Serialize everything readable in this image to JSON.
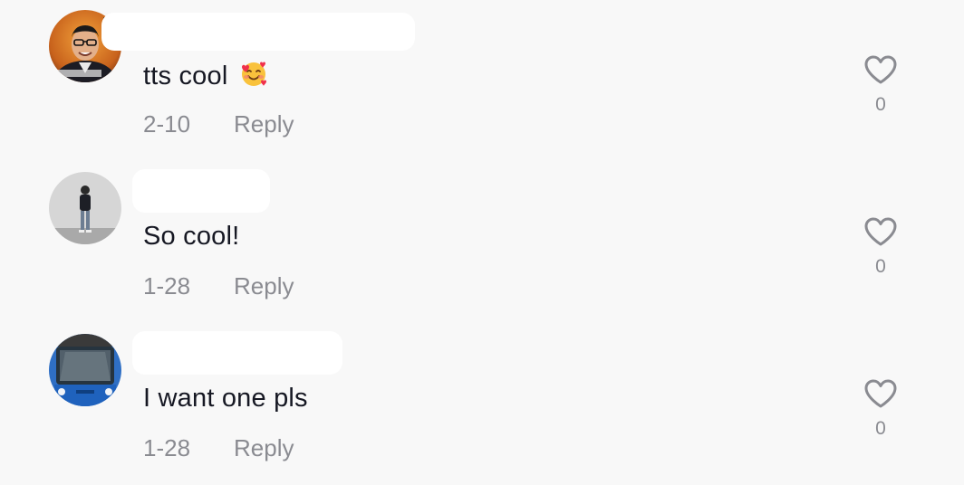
{
  "comments": [
    {
      "text": "tts cool",
      "emoji": "smiling-face-with-hearts",
      "date": "2-10",
      "reply_label": "Reply",
      "likes": "0"
    },
    {
      "text": "So cool!",
      "date": "1-28",
      "reply_label": "Reply",
      "likes": "0"
    },
    {
      "text": "I want one pls",
      "date": "1-28",
      "reply_label": "Reply",
      "likes": "0"
    }
  ],
  "colors": {
    "background": "#f8f8f8",
    "text_primary": "#161823",
    "text_secondary": "#8a8b91",
    "heart_outline": "#8a8b91"
  },
  "icons": {
    "like": "heart-outline-icon",
    "emoji": "smiling-face-with-hearts-icon"
  }
}
